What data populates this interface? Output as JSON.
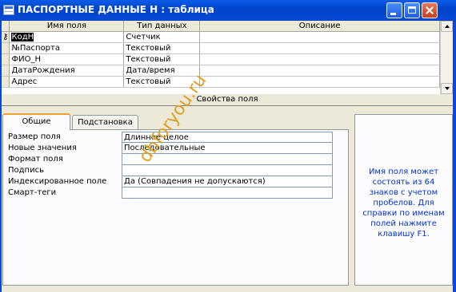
{
  "window": {
    "title": "ПАСПОРТНЫЕ ДАННЫЕ Н : таблица"
  },
  "grid": {
    "columns": [
      "Имя поля",
      "Тип данных",
      "Описание"
    ],
    "rows": [
      {
        "name": "КодН",
        "type": "Счетчик",
        "description": ""
      },
      {
        "name": "№Паспорта",
        "type": "Текстовый",
        "description": ""
      },
      {
        "name": "ФИО_Н",
        "type": "Текстовый",
        "description": ""
      },
      {
        "name": "ДатаРождения",
        "type": "Дата/время",
        "description": ""
      },
      {
        "name": "Адрес",
        "type": "Текстовый",
        "description": ""
      }
    ],
    "selected_row": 0
  },
  "properties": {
    "heading": "Свойства поля",
    "tabs": [
      "Общие",
      "Подстановка"
    ],
    "active_tab": "Общие",
    "items": [
      {
        "label": "Размер поля",
        "value": "Длинное целое"
      },
      {
        "label": "Новые значения",
        "value": "Последовательные"
      },
      {
        "label": "Формат поля",
        "value": ""
      },
      {
        "label": "Подпись",
        "value": ""
      },
      {
        "label": "Индексированное поле",
        "value": "Да (Совпадения не допускаются)"
      },
      {
        "label": "Смарт-теги",
        "value": ""
      }
    ]
  },
  "help": {
    "text": "Имя поля может состоять из 64 знаков с учетом пробелов.  Для справки по именам полей нажмите клавишу F1."
  },
  "watermark": "dbforyou.ru",
  "colors": {
    "titlebar": "#0a49d6",
    "help_text": "#0033cc",
    "watermark": "#e0a020"
  }
}
